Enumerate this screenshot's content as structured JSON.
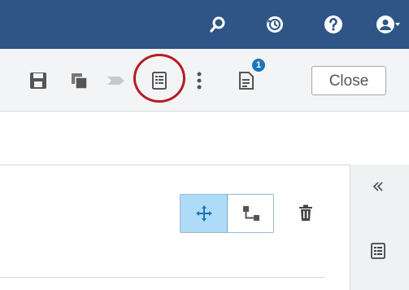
{
  "header": {
    "icons": [
      "search-icon",
      "history-icon",
      "help-icon",
      "user-icon"
    ],
    "color": "#2f5587"
  },
  "toolbar": {
    "icons": [
      "save-icon",
      "copy-icon",
      "send-icon",
      "outline-icon",
      "more-vertical-icon",
      "notifications-icon"
    ],
    "notification_count": "1",
    "close_label": "Close",
    "highlight_color": "#b61c24"
  },
  "diagram": {
    "tools": [
      "move-icon",
      "connect-icon",
      "trash-icon"
    ],
    "selected_tool": "move-icon",
    "selected_color": "#aedcf8"
  },
  "side_panel": {
    "icons": [
      "collapse-icon",
      "outline-icon"
    ]
  }
}
